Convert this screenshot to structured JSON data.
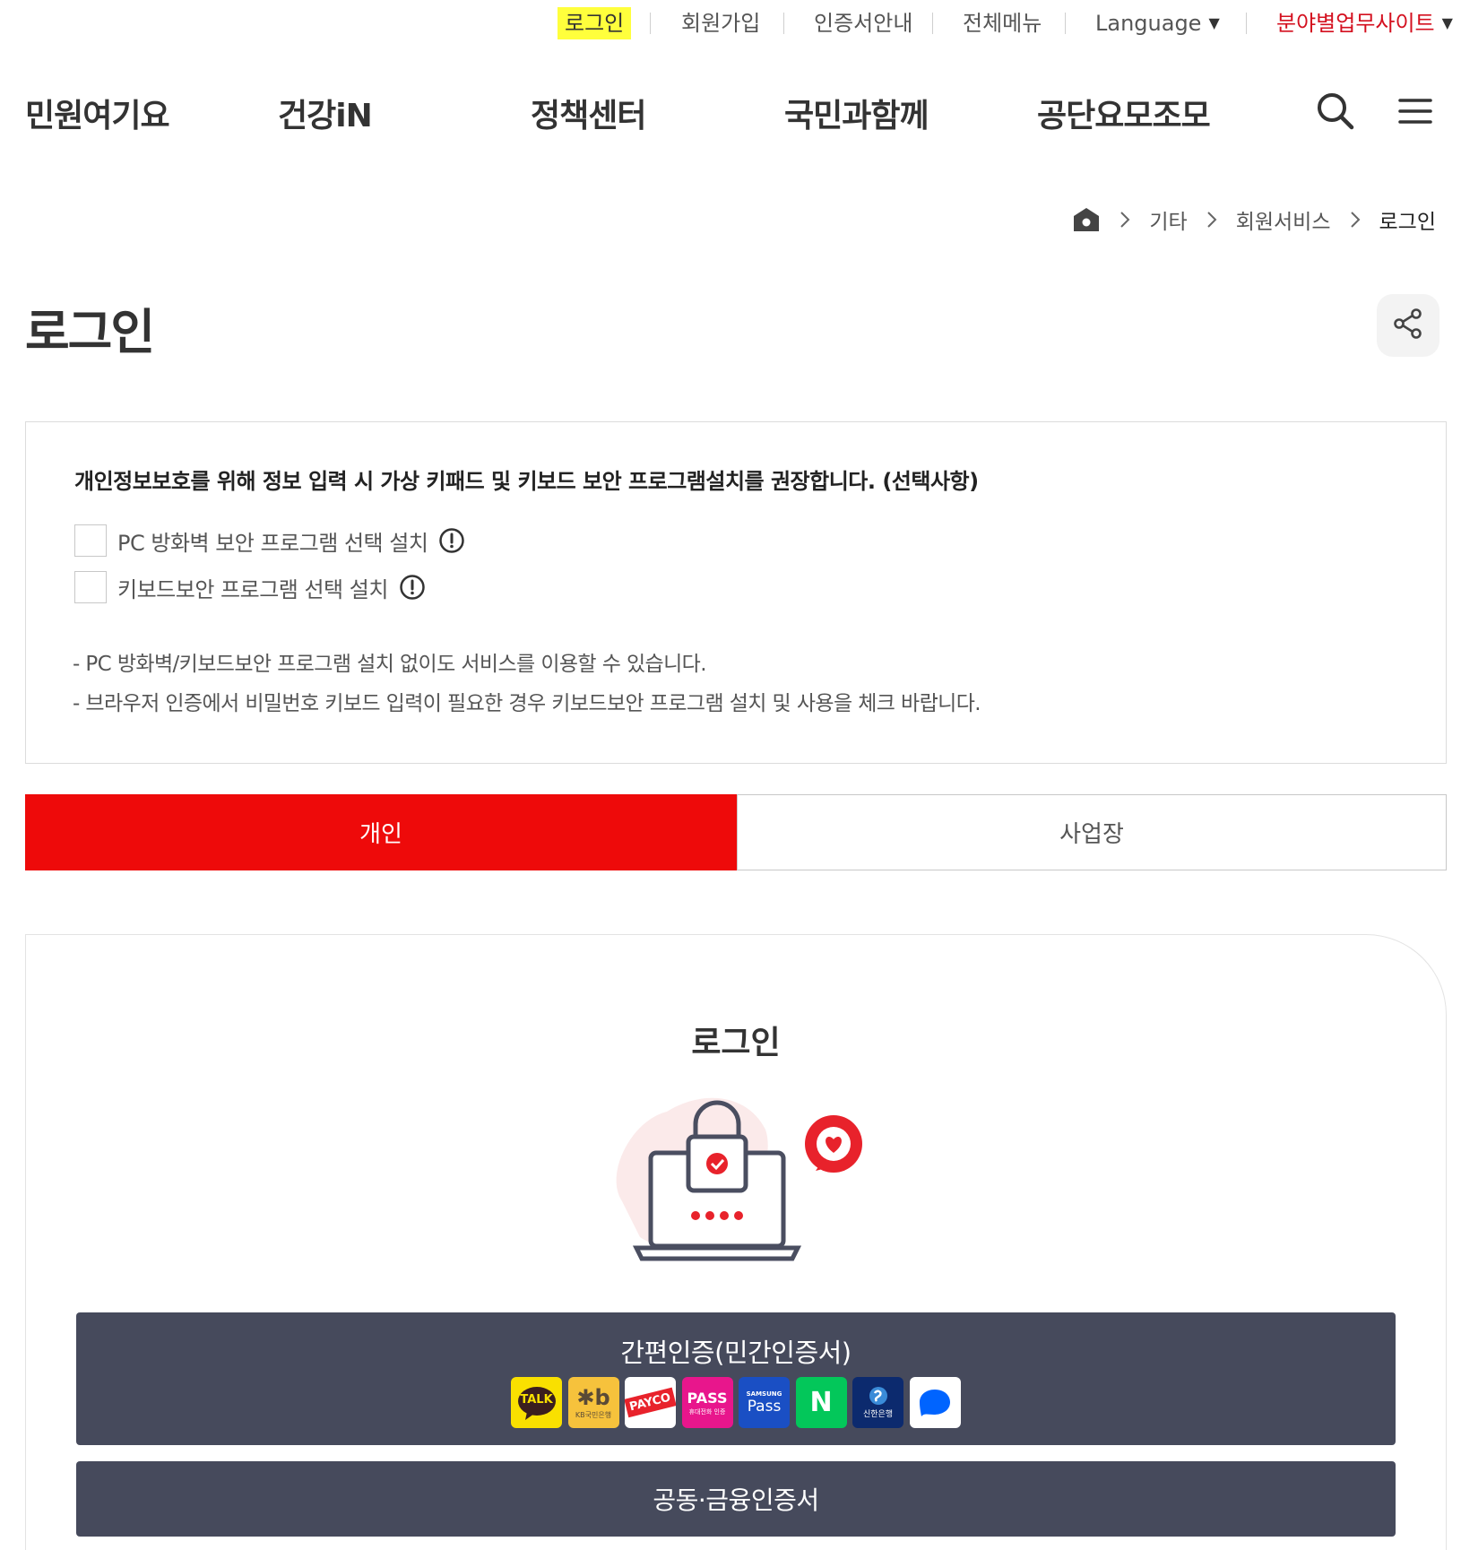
{
  "utility_nav": {
    "login": "로그인",
    "signup": "회원가입",
    "cert_guide": "인증서안내",
    "all_menu": "전체메뉴",
    "language": "Language",
    "business_sites": "분야별업무사이트"
  },
  "gnb": {
    "items": [
      "민원여기요",
      "건강iN",
      "정책센터",
      "국민과함께",
      "공단요모조모"
    ]
  },
  "breadcrumb": {
    "items": [
      "기타",
      "회원서비스"
    ],
    "current": "로그인"
  },
  "page": {
    "title": "로그인"
  },
  "security_notice": {
    "title": "개인정보보호를 위해 정보 입력 시 가상 키패드 및 키보드 보안 프로그램설치를 권장합니다. (선택사항)",
    "options": [
      {
        "label": "PC 방화벽 보안 프로그램 선택 설치",
        "checked": false
      },
      {
        "label": "키보드보안 프로그램 선택 설치",
        "checked": false
      }
    ],
    "notes": [
      "- PC 방화벽/키보드보안 프로그램 설치 없이도 서비스를 이용할 수 있습니다.",
      "- 브라우저 인증에서 비밀번호 키보드 입력이 필요한 경우 키보드보안 프로그램 설치 및 사용을 체크 바랍니다."
    ]
  },
  "tabs": {
    "personal": "개인",
    "business": "사업장",
    "active": "personal"
  },
  "login_card": {
    "title": "로그인",
    "simple_auth_label": "간편인증(민간인증서)",
    "providers": [
      {
        "name": "kakao-talk",
        "label": "TALK"
      },
      {
        "name": "kb-bank",
        "label": "KB국민은행"
      },
      {
        "name": "payco",
        "label": "PAYCO"
      },
      {
        "name": "pass",
        "label": "PASS",
        "sublabel": "휴대전화 인증"
      },
      {
        "name": "samsung-pass",
        "label": "Pass",
        "sublabel": "SAMSUNG"
      },
      {
        "name": "naver",
        "label": "N"
      },
      {
        "name": "shinhan-bank",
        "label": "신한은행"
      },
      {
        "name": "toss",
        "label": ""
      }
    ],
    "cert_button_label": "공동·금융인증서"
  },
  "colors": {
    "accent_red": "#ee0a0a",
    "highlight_yellow": "#ffff3c",
    "button_dark": "#464a5c",
    "business_sites_red": "#d4101f"
  },
  "icons": [
    "search-icon",
    "hamburger-menu-icon",
    "home-icon",
    "chevron-right-icon",
    "share-icon",
    "info-icon",
    "caret-down-icon"
  ]
}
